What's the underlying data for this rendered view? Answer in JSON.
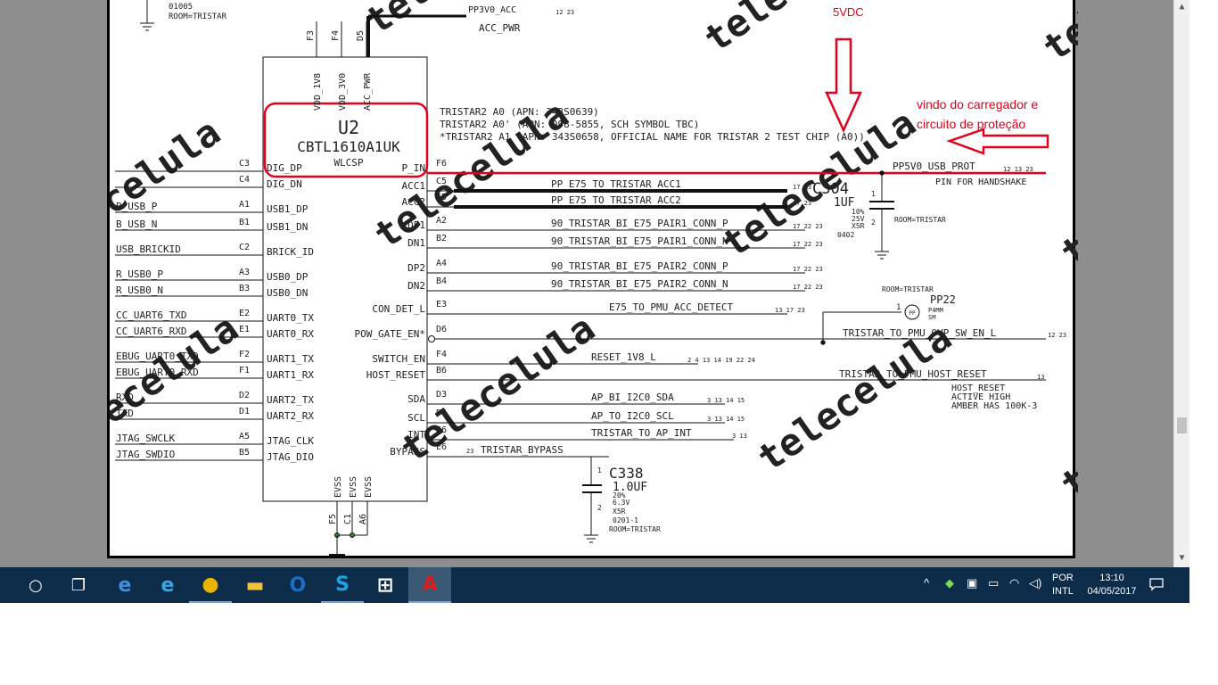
{
  "annotations": {
    "voltage_label": "5VDC",
    "note_line1": "vindo do carregador e",
    "note_line2": "circuito de proteção",
    "color": "#e3001b"
  },
  "watermark": "telecelula",
  "schematic": {
    "top_net": "PP3V0_ACC",
    "top_net_refs": "12 23",
    "top_net_sub": "ACC_PWR",
    "top_left": {
      "line1": "01005",
      "line2": "ROOM=TRISTAR"
    },
    "chip": {
      "ref": "U2",
      "part": "CBTL1610A1UK",
      "package": "WLCSP",
      "top_pins": [
        {
          "ball": "F3",
          "name": "VDD_1V8"
        },
        {
          "ball": "F4",
          "name": "VDD_3V0"
        },
        {
          "ball": "D5",
          "name": "ACC_PWR"
        }
      ],
      "bottom_pins": [
        {
          "ball": "F5",
          "name": "EVSS"
        },
        {
          "ball": "C1",
          "name": "EVSS"
        },
        {
          "ball": "A6",
          "name": "EVSS"
        }
      ],
      "notes": [
        "TRISTAR2 A0 (APN: 343S0639)",
        "TRISTAR2 A0' (APN: 998-5855, SCH SYMBOL TBC)",
        "*TRISTAR2 A1 (APN: 343S0658, OFFICIAL NAME FOR TRISTAR 2 TEST CHIP (A0))"
      ],
      "left_pins": [
        {
          "ball": "C3",
          "name": "DIG_DP",
          "net": ""
        },
        {
          "ball": "C4",
          "name": "DIG_DN",
          "net": ""
        },
        {
          "ball": "A1",
          "name": "USB1_DP",
          "net": "B_USB_P"
        },
        {
          "ball": "B1",
          "name": "USB1_DN",
          "net": "B_USB_N"
        },
        {
          "ball": "C2",
          "name": "BRICK_ID",
          "net": "USB_BRICKID"
        },
        {
          "ball": "A3",
          "name": "USB0_DP",
          "net": "R_USB0_P"
        },
        {
          "ball": "B3",
          "name": "USB0_DN",
          "net": "R_USB0_N"
        },
        {
          "ball": "E2",
          "name": "UART0_TX",
          "net": "CC_UART6_TXD"
        },
        {
          "ball": "E1",
          "name": "UART0_RX",
          "net": "CC_UART6_RXD"
        },
        {
          "ball": "F2",
          "name": "UART1_TX",
          "net": "EBUG_UART0_TXD"
        },
        {
          "ball": "F1",
          "name": "UART1_RX",
          "net": "EBUG_UART0_RXD"
        },
        {
          "ball": "D2",
          "name": "UART2_TX",
          "net": "RXD"
        },
        {
          "ball": "D1",
          "name": "UART2_RX",
          "net": "TXD"
        },
        {
          "ball": "A5",
          "name": "JTAG_CLK",
          "net": "JTAG_SWCLK"
        },
        {
          "ball": "B5",
          "name": "JTAG_DIO",
          "net": "JTAG_SWDIO"
        }
      ],
      "right_pins": [
        {
          "ball": "F6",
          "name": "P_IN",
          "net": "PP5V0_USB_PROT",
          "refs": "12 13 23"
        },
        {
          "ball": "C5",
          "name": "ACC1",
          "net": "PP_E75_TO_TRISTAR_ACC1",
          "refs": "17 23"
        },
        {
          "ball": "E5",
          "name": "ACC2",
          "net": "PP_E75_TO_TRISTAR_ACC2",
          "refs": "17 23"
        },
        {
          "ball": "A2",
          "name": "DP1",
          "net": "90_TRISTAR_BI_E75_PAIR1_CONN_P",
          "refs": "17 22 23"
        },
        {
          "ball": "B2",
          "name": "DN1",
          "net": "90_TRISTAR_BI_E75_PAIR1_CONN_N",
          "refs": "17 22 23"
        },
        {
          "ball": "A4",
          "name": "DP2",
          "net": "90_TRISTAR_BI_E75_PAIR2_CONN_P",
          "refs": "17 22 23"
        },
        {
          "ball": "B4",
          "name": "DN2",
          "net": "90_TRISTAR_BI_E75_PAIR2_CONN_N",
          "refs": "17 22 23"
        },
        {
          "ball": "E3",
          "name": "CON_DET_L",
          "net": "E75_TO_PMU_ACC_DETECT",
          "refs": "13 17 23"
        },
        {
          "ball": "D6",
          "name": "POW_GATE_EN*",
          "net": "",
          "refs": ""
        },
        {
          "ball": "F4",
          "name": "SWITCH_EN",
          "net": "RESET_1V8_L",
          "refs": "2 4 13 14 19 22 24"
        },
        {
          "ball": "B6",
          "name": "HOST_RESET",
          "net": "",
          "refs": ""
        },
        {
          "ball": "D3",
          "name": "SDA",
          "net": "AP_BI_I2C0_SDA",
          "refs": "3 13 14 15"
        },
        {
          "ball": "D4",
          "name": "SCL",
          "net": "AP_TO_I2C0_SCL",
          "refs": "3 13 14 15"
        },
        {
          "ball": "C6",
          "name": "INT",
          "net": "TRISTAR_TO_AP_INT",
          "refs": "3 13"
        },
        {
          "ball": "E6",
          "name": "BYPASS",
          "net": "TRISTAR_BYPASS",
          "refs": "23"
        }
      ]
    },
    "pin_for_handshake": "PIN FOR HANDSHAKE",
    "c304": {
      "ref": "C304",
      "value": "1UF",
      "tol": "10%",
      "volt": "25V",
      "diel": "X5R",
      "size": "0402",
      "room": "ROOM=TRISTAR",
      "pin1": "1",
      "pin2": "2"
    },
    "pp22": {
      "room": "ROOM=TRISTAR",
      "ref": "PP22",
      "size": "P4MM",
      "sm": "SM",
      "pin": "1",
      "body": "PP"
    },
    "ovp_net": "TRISTAR_TO_PMU_OVP_SW_EN_L",
    "ovp_refs": "12 23",
    "host_reset_net": "TRISTAR_TO_PMU_HOST_RESET",
    "host_reset_refs": "13",
    "host_reset_note": [
      "HOST_RESET",
      "ACTIVE HIGH",
      "AMBER HAS 100K-3"
    ],
    "c338": {
      "ref": "C338",
      "value": "1.0UF",
      "tol": "20%",
      "volt": "6.3V",
      "diel": "X5R",
      "size": "0201-1",
      "room": "ROOM=TRISTAR",
      "pin1": "1",
      "pin2": "2"
    }
  },
  "taskbar": {
    "apps": [
      {
        "name": "start",
        "glyph": "○"
      },
      {
        "name": "task-view",
        "glyph": "❐"
      },
      {
        "name": "edge",
        "glyph": "e",
        "color": "#3b8ee0"
      },
      {
        "name": "internet-explorer",
        "glyph": "e",
        "color": "#35a7e8"
      },
      {
        "name": "chrome",
        "glyph": "●",
        "color": "#e8b400"
      },
      {
        "name": "file-explorer",
        "glyph": "▬",
        "color": "#f3c23c"
      },
      {
        "name": "outlook",
        "glyph": "O",
        "color": "#1a6fc4"
      },
      {
        "name": "skype",
        "glyph": "S",
        "color": "#1aa6e6"
      },
      {
        "name": "store",
        "glyph": "⊞",
        "color": "#ffffff"
      },
      {
        "name": "acrobat",
        "glyph": "A",
        "color": "#d81e1e"
      }
    ],
    "tray": {
      "chevron": "^",
      "lang_line1": "POR",
      "lang_line2": "INTL",
      "time": "13:10",
      "date": "04/05/2017"
    }
  }
}
